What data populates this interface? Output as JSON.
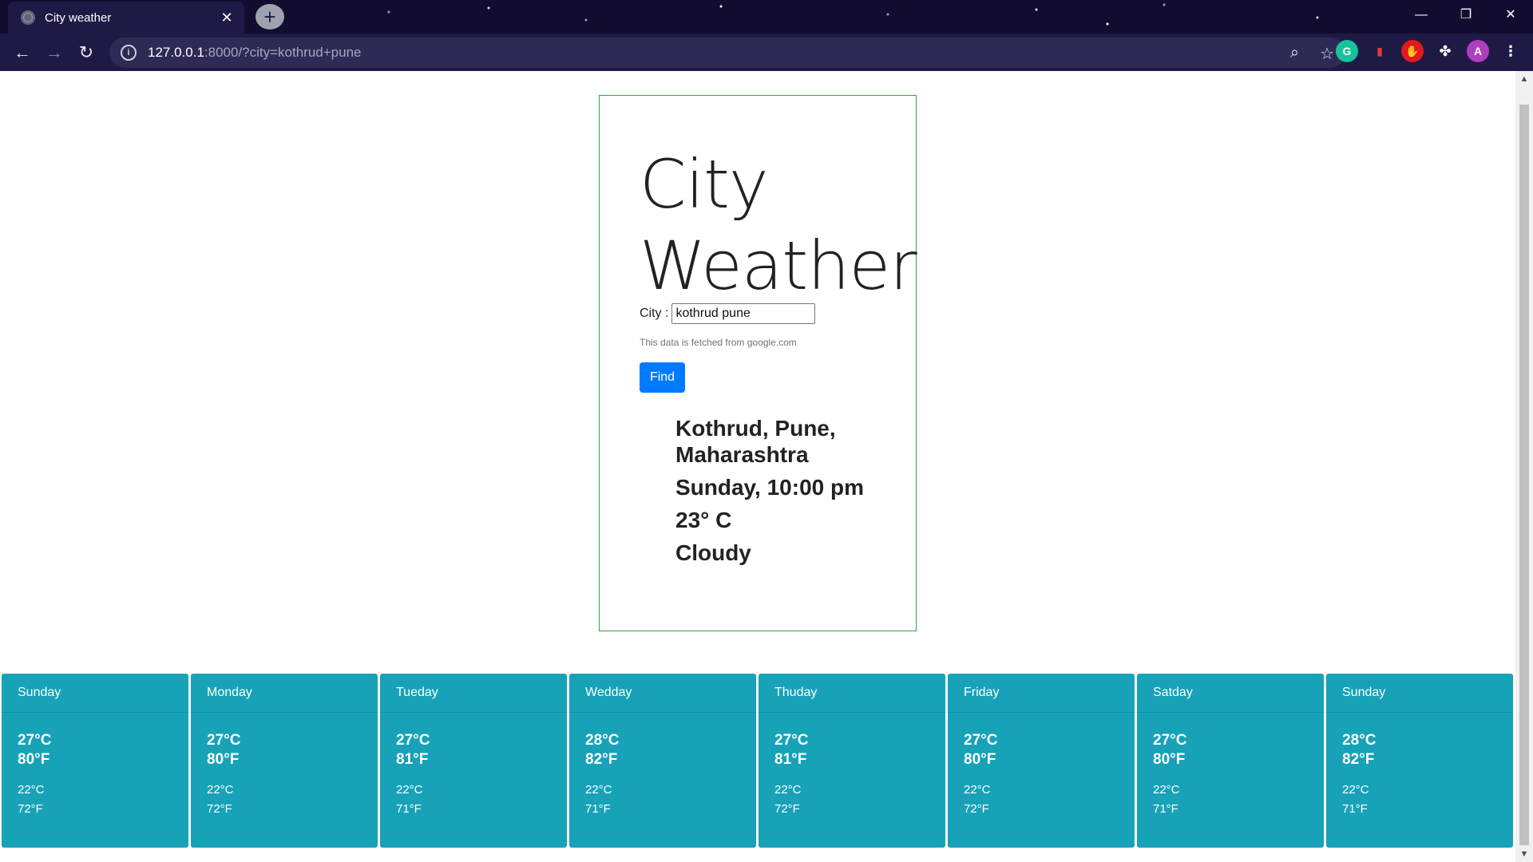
{
  "browser": {
    "tab_title": "City weather",
    "url_host": "127.0.0.1",
    "url_path": ":8000/?city=kothrud+pune"
  },
  "app": {
    "heading_line1": "City",
    "heading_line2": "Weather",
    "city_label": "City :",
    "city_value": "kothrud pune",
    "note": "This data is fetched from google.com",
    "find_label": "Find"
  },
  "result": {
    "location": "Kothrud, Pune, Maharashtra",
    "datetime": "Sunday, 10:00 pm",
    "temperature": "23° C",
    "condition": "Cloudy"
  },
  "forecast": [
    {
      "day": "Sunday",
      "hi_c": "27°C",
      "hi_f": "80°F",
      "lo_c": "22°C",
      "lo_f": "72°F"
    },
    {
      "day": "Monday",
      "hi_c": "27°C",
      "hi_f": "80°F",
      "lo_c": "22°C",
      "lo_f": "72°F"
    },
    {
      "day": "Tueday",
      "hi_c": "27°C",
      "hi_f": "81°F",
      "lo_c": "22°C",
      "lo_f": "71°F"
    },
    {
      "day": "Wedday",
      "hi_c": "28°C",
      "hi_f": "82°F",
      "lo_c": "22°C",
      "lo_f": "71°F"
    },
    {
      "day": "Thuday",
      "hi_c": "27°C",
      "hi_f": "81°F",
      "lo_c": "22°C",
      "lo_f": "72°F"
    },
    {
      "day": "Friday",
      "hi_c": "27°C",
      "hi_f": "80°F",
      "lo_c": "22°C",
      "lo_f": "72°F"
    },
    {
      "day": "Satday",
      "hi_c": "27°C",
      "hi_f": "80°F",
      "lo_c": "22°C",
      "lo_f": "71°F"
    },
    {
      "day": "Sunday",
      "hi_c": "28°C",
      "hi_f": "82°F",
      "lo_c": "22°C",
      "lo_f": "71°F"
    }
  ],
  "colors": {
    "card_border": "#28a745",
    "find_button": "#007bff",
    "forecast_card": "#17a2b8"
  }
}
